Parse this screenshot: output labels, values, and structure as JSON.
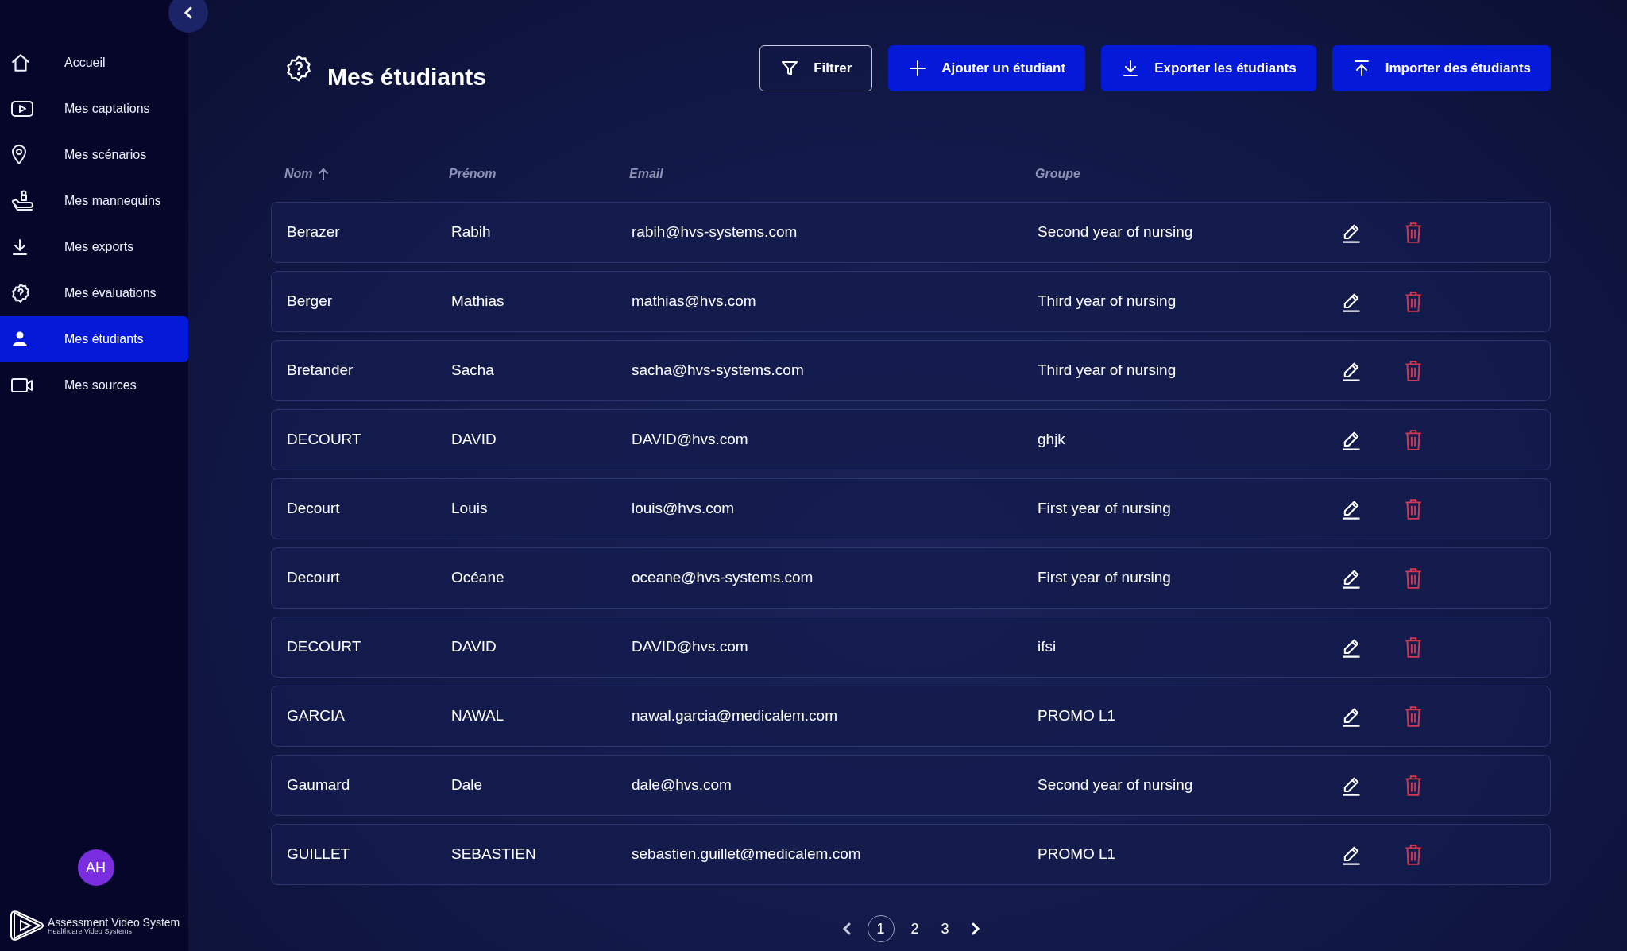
{
  "sidebar": {
    "items": [
      {
        "label": "Accueil",
        "selected": false
      },
      {
        "label": "Mes captations",
        "selected": false
      },
      {
        "label": "Mes scénarios",
        "selected": false
      },
      {
        "label": "Mes mannequins",
        "selected": false
      },
      {
        "label": "Mes exports",
        "selected": false
      },
      {
        "label": "Mes évaluations",
        "selected": false
      },
      {
        "label": "Mes étudiants",
        "selected": true
      },
      {
        "label": "Mes sources",
        "selected": false
      }
    ],
    "avatar": "AH",
    "logo": {
      "title": "Assessment Video System",
      "subtitle": "Healthcare Video Systems"
    }
  },
  "page": {
    "title": "Mes étudiants"
  },
  "toolbar": [
    {
      "label": "Filtrer",
      "kind": "outline"
    },
    {
      "label": "Ajouter un étudiant",
      "kind": "primary"
    },
    {
      "label": "Exporter les étudiants",
      "kind": "primary"
    },
    {
      "label": "Importer des étudiants",
      "kind": "primary"
    }
  ],
  "table": {
    "columns": [
      {
        "label": "Nom",
        "sorted": true
      },
      {
        "label": "Prénom",
        "sorted": false
      },
      {
        "label": "Email",
        "sorted": false
      },
      {
        "label": "Groupe",
        "sorted": false
      }
    ],
    "rows": [
      [
        "Berazer",
        "Rabih",
        "rabih@hvs-systems.com",
        "Second year of nursing"
      ],
      [
        "Berger",
        "Mathias",
        "mathias@hvs.com",
        "Third year of nursing"
      ],
      [
        "Bretander",
        "Sacha",
        "sacha@hvs-systems.com",
        "Third year of nursing"
      ],
      [
        "DECOURT",
        "DAVID",
        "DAVID@hvs.com",
        "ghjk"
      ],
      [
        "Decourt",
        "Louis",
        "louis@hvs.com",
        "First year of nursing"
      ],
      [
        "Decourt",
        "Océane",
        "oceane@hvs-systems.com",
        "First year of nursing"
      ],
      [
        "DECOURT",
        "DAVID",
        "DAVID@hvs.com",
        "ifsi"
      ],
      [
        "GARCIA",
        "NAWAL",
        "nawal.garcia@medicalem.com",
        "PROMO L1"
      ],
      [
        "Gaumard",
        "Dale",
        "dale@hvs.com",
        "Second year of nursing"
      ],
      [
        "GUILLET",
        "SEBASTIEN",
        "sebastien.guillet@medicalem.com",
        "PROMO L1"
      ]
    ]
  },
  "pagination": {
    "pages": [
      {
        "label": "1",
        "selected": true
      },
      {
        "label": "2",
        "selected": false
      },
      {
        "label": "3",
        "selected": false
      }
    ]
  }
}
